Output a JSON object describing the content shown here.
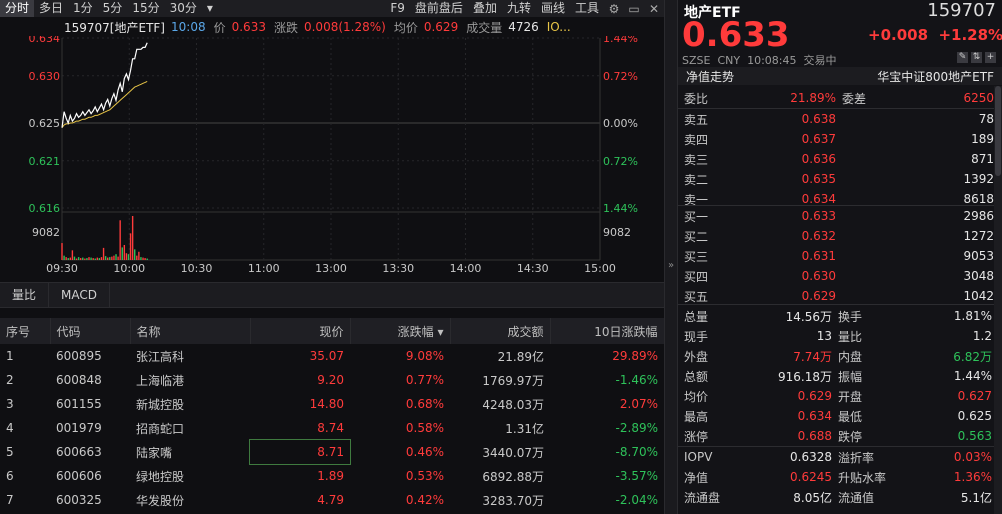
{
  "toolbar": {
    "tabs": [
      "分时",
      "多日",
      "1分",
      "5分",
      "15分",
      "30分"
    ],
    "more": "▾",
    "right_items": [
      "F9",
      "盘前盘后",
      "叠加",
      "九转",
      "画线",
      "工具"
    ]
  },
  "info": {
    "code_name": "159707[地产ETF]",
    "time": "10:08",
    "price_label": "价",
    "price": "0.633",
    "chg_label": "涨跌",
    "chg": "0.008(1.28%)",
    "avg_label": "均价",
    "avg": "0.629",
    "vol_label": "成交量",
    "vol": "4726",
    "iopv": "IO..."
  },
  "chart_data": {
    "type": "line",
    "y_ticks_left": [
      "0.634",
      "0.630",
      "0.625",
      "0.621",
      "0.616"
    ],
    "y_ticks_right": [
      "1.44%",
      "0.72%",
      "0.00%",
      "0.72%",
      "1.44%"
    ],
    "vol_tick_left": "9082",
    "vol_tick_right": "9082",
    "x_ticks": [
      "09:30",
      "10:30",
      "11:00",
      "13:00",
      "13:30",
      "14:00",
      "14:30",
      "15:00"
    ],
    "x_tick_extra": "10:00",
    "ylim": [
      0.616,
      0.634
    ],
    "prev_close": 0.625,
    "price": [
      0.6245,
      0.6262,
      0.6255,
      0.625,
      0.6258,
      0.6252,
      0.6255,
      0.626,
      0.6256,
      0.6258,
      0.6262,
      0.6258,
      0.6261,
      0.6264,
      0.626,
      0.6263,
      0.6267,
      0.6262,
      0.6266,
      0.627,
      0.6264,
      0.6271,
      0.6275,
      0.6268,
      0.6276,
      0.6281,
      0.6274,
      0.6285,
      0.6292,
      0.6283,
      0.6297,
      0.6302,
      0.6296,
      0.6306,
      0.6318,
      0.6318,
      0.6328,
      0.6328,
      0.6328,
      0.633,
      0.633,
      0.6335
    ],
    "avg": [
      0.6245,
      0.6248,
      0.6249,
      0.6249,
      0.625,
      0.625,
      0.6251,
      0.6252,
      0.6252,
      0.6253,
      0.6254,
      0.6254,
      0.6255,
      0.6256,
      0.6256,
      0.6257,
      0.6258,
      0.6258,
      0.6259,
      0.626,
      0.6261,
      0.6262,
      0.6263,
      0.6264,
      0.6266,
      0.6268,
      0.627,
      0.6272,
      0.6274,
      0.6276,
      0.6278,
      0.628,
      0.6282,
      0.6284,
      0.6286,
      0.6288,
      0.6289,
      0.629,
      0.6291,
      0.6292,
      0.6293,
      0.6294
    ],
    "volume": [
      3500,
      900,
      600,
      400,
      500,
      2000,
      700,
      300,
      600,
      400,
      500,
      300,
      400,
      600,
      500,
      400,
      300,
      500,
      400,
      600,
      2500,
      800,
      500,
      600,
      700,
      900,
      1200,
      700,
      8200,
      2600,
      3100,
      1400,
      1200,
      5500,
      9082,
      2200,
      900,
      1700,
      600,
      500,
      400,
      300
    ],
    "vol_up": [
      true,
      false,
      true,
      false,
      true,
      true,
      false,
      true,
      false,
      true,
      false,
      true,
      false,
      true,
      false,
      true,
      false,
      true,
      false,
      true,
      true,
      false,
      true,
      false,
      true,
      true,
      false,
      true,
      true,
      false,
      true,
      true,
      false,
      true,
      true,
      false,
      true,
      true,
      false,
      true,
      true,
      false
    ]
  },
  "subtabs": [
    "量比",
    "MACD"
  ],
  "table": {
    "headers": [
      "序号",
      "代码",
      "名称",
      "现价",
      "涨跌幅 ▾",
      "成交额",
      "10日涨跌幅"
    ],
    "rows": [
      {
        "no": "1",
        "code": "600895",
        "name": "张江高科",
        "price": "35.07",
        "chg": "9.08%",
        "amt": "21.89亿",
        "chg10": "29.89%",
        "dir": "up",
        "dir10": "up"
      },
      {
        "no": "2",
        "code": "600848",
        "name": "上海临港",
        "price": "9.20",
        "chg": "0.77%",
        "amt": "1769.97万",
        "chg10": "-1.46%",
        "dir": "up",
        "dir10": "dn"
      },
      {
        "no": "3",
        "code": "601155",
        "name": "新城控股",
        "price": "14.80",
        "chg": "0.68%",
        "amt": "4248.03万",
        "chg10": "2.07%",
        "dir": "up",
        "dir10": "up"
      },
      {
        "no": "4",
        "code": "001979",
        "name": "招商蛇口",
        "price": "8.74",
        "chg": "0.58%",
        "amt": "1.31亿",
        "chg10": "-2.89%",
        "dir": "up",
        "dir10": "dn"
      },
      {
        "no": "5",
        "code": "600663",
        "name": "陆家嘴",
        "price": "8.71",
        "chg": "0.46%",
        "amt": "3440.07万",
        "chg10": "-8.70%",
        "dir": "up",
        "dir10": "dn"
      },
      {
        "no": "6",
        "code": "600606",
        "name": "绿地控股",
        "price": "1.89",
        "chg": "0.53%",
        "amt": "6892.88万",
        "chg10": "-3.57%",
        "dir": "up",
        "dir10": "dn"
      },
      {
        "no": "7",
        "code": "600325",
        "name": "华发股份",
        "price": "4.79",
        "chg": "0.42%",
        "amt": "3283.70万",
        "chg10": "-2.04%",
        "dir": "up",
        "dir10": "dn"
      }
    ]
  },
  "right": {
    "name": "地产ETF",
    "code": "159707",
    "price": "0.633",
    "chg": "+0.008",
    "chg_pct": "+1.28%",
    "market": "SZSE",
    "currency": "CNY",
    "time": "10:08:45",
    "status": "交易中",
    "tab_left": "净值走势",
    "tab_right": "华宝中证800地产ETF",
    "wei_label": "委比",
    "wei_val": "21.89%",
    "cha_label": "委差",
    "cha_val": "6250",
    "asks": [
      {
        "label": "卖五",
        "price": "0.638",
        "vol": "78"
      },
      {
        "label": "卖四",
        "price": "0.637",
        "vol": "189"
      },
      {
        "label": "卖三",
        "price": "0.636",
        "vol": "871"
      },
      {
        "label": "卖二",
        "price": "0.635",
        "vol": "1392"
      },
      {
        "label": "卖一",
        "price": "0.634",
        "vol": "8618"
      }
    ],
    "bids": [
      {
        "label": "买一",
        "price": "0.633",
        "vol": "2986"
      },
      {
        "label": "买二",
        "price": "0.632",
        "vol": "1272"
      },
      {
        "label": "买三",
        "price": "0.631",
        "vol": "9053"
      },
      {
        "label": "买四",
        "price": "0.630",
        "vol": "3048"
      },
      {
        "label": "买五",
        "price": "0.629",
        "vol": "1042"
      }
    ],
    "stats": [
      {
        "l1": "总量",
        "v1": "14.56万",
        "c1": "wh",
        "l2": "换手",
        "v2": "1.81%",
        "c2": "wh"
      },
      {
        "l1": "现手",
        "v1": "13",
        "c1": "wh",
        "l2": "量比",
        "v2": "1.2",
        "c2": "wh"
      },
      {
        "l1": "外盘",
        "v1": "7.74万",
        "c1": "up",
        "l2": "内盘",
        "v2": "6.82万",
        "c2": "dn"
      },
      {
        "l1": "总额",
        "v1": "916.18万",
        "c1": "wh",
        "l2": "振幅",
        "v2": "1.44%",
        "c2": "wh"
      },
      {
        "l1": "均价",
        "v1": "0.629",
        "c1": "up",
        "l2": "开盘",
        "v2": "0.627",
        "c2": "up"
      },
      {
        "l1": "最高",
        "v1": "0.634",
        "c1": "up",
        "l2": "最低",
        "v2": "0.625",
        "c2": "wh"
      },
      {
        "l1": "涨停",
        "v1": "0.688",
        "c1": "up",
        "l2": "跌停",
        "v2": "0.563",
        "c2": "dn"
      }
    ],
    "stats2": [
      {
        "l1": "IOPV",
        "v1": "0.6328",
        "c1": "wh",
        "l2": "溢折率",
        "v2": "0.03%",
        "c2": "up"
      },
      {
        "l1": "净值",
        "v1": "0.6245",
        "c1": "up",
        "l2": "升贴水率",
        "v2": "1.36%",
        "c2": "up"
      },
      {
        "l1": "流通盘",
        "v1": "8.05亿",
        "c1": "wh",
        "l2": "流通值",
        "v2": "5.1亿",
        "c2": "wh"
      }
    ]
  }
}
